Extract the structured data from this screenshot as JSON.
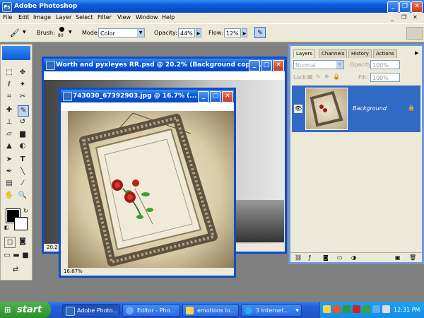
{
  "app": {
    "title": "Adobe Photoshop"
  },
  "menu": [
    "File",
    "Edit",
    "Image",
    "Layer",
    "Select",
    "Filter",
    "View",
    "Window",
    "Help"
  ],
  "options": {
    "brush_label": "Brush:",
    "brush_size": "80",
    "mode_label": "Mode:",
    "mode_value": "Color",
    "opacity_label": "Opacity:",
    "opacity_value": "44%",
    "flow_label": "Flow:",
    "flow_value": "12%"
  },
  "doc_back": {
    "title": "Worth and pyxleyes RR.psd @ 20.2% (Background copy ...",
    "zoom": "20.2"
  },
  "doc_front": {
    "title": "743030_67392903.jpg @ 16.7% (...",
    "zoom": "16.67%"
  },
  "layers_panel": {
    "tabs": [
      "Layers",
      "Channels",
      "History",
      "Actions"
    ],
    "blend_mode": "Normal",
    "opacity_label": "Opacity:",
    "opacity_value": "100%",
    "lock_label": "Lock:",
    "fill_label": "Fill:",
    "fill_value": "100%",
    "layer_name": "Background"
  },
  "taskbar": {
    "start": "start",
    "buttons": [
      "Adobe Photo...",
      "Editor - Pho...",
      "emotions lo...",
      "3 Internet..."
    ],
    "clock": "12:31 PM"
  },
  "colors": {
    "selection": "#316ac5",
    "xp_blue": "#0a5ad8",
    "start_green": "#3a9e3a",
    "panel_bg": "#ece9d8"
  }
}
